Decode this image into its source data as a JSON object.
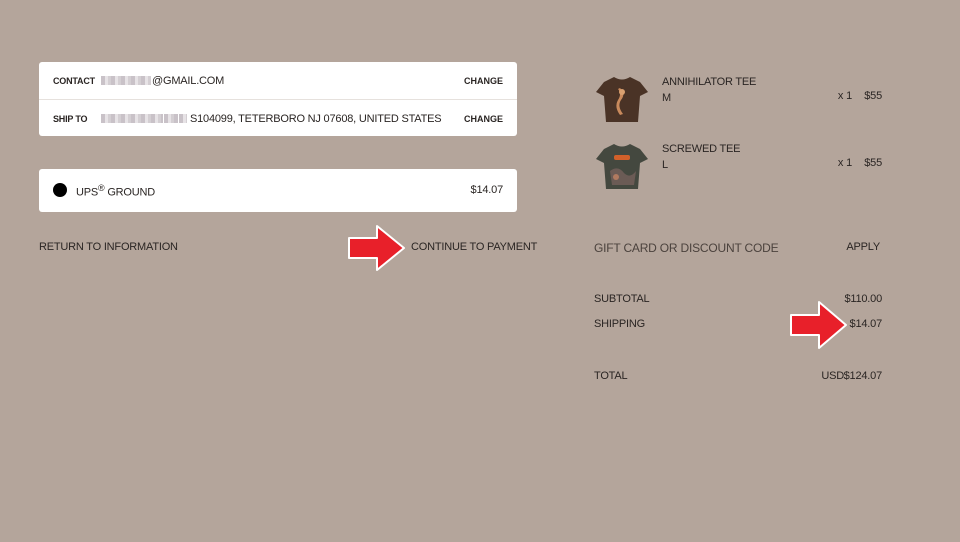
{
  "contact": {
    "label": "CONTACT",
    "email_suffix": "@GMAIL.COM",
    "change": "CHANGE"
  },
  "ship_to": {
    "label": "SHIP TO",
    "address_suffix": "S104099, TETERBORO NJ 07608, UNITED STATES",
    "change": "CHANGE"
  },
  "shipping_method": {
    "carrier": "UPS",
    "registered": "®",
    "service": "GROUND",
    "price": "$14.07",
    "selected": true
  },
  "nav": {
    "return_label": "RETURN TO INFORMATION",
    "continue_label": "CONTINUE TO PAYMENT"
  },
  "cart": {
    "items": [
      {
        "name": "ANNIHILATOR TEE",
        "size": "M",
        "qty": "x 1",
        "price": "$55"
      },
      {
        "name": "SCREWED TEE",
        "size": "L",
        "qty": "x 1",
        "price": "$55"
      }
    ],
    "discount_placeholder": "GIFT CARD OR DISCOUNT CODE",
    "apply_label": "APPLY"
  },
  "summary": {
    "subtotal_label": "SUBTOTAL",
    "subtotal": "$110.00",
    "shipping_label": "SHIPPING",
    "shipping": "$14.07",
    "total_label": "TOTAL",
    "currency": "USD",
    "total": "$124.07"
  },
  "colors": {
    "background": "#b4a59b",
    "card": "#ffffff",
    "arrow": "#e8202a"
  }
}
